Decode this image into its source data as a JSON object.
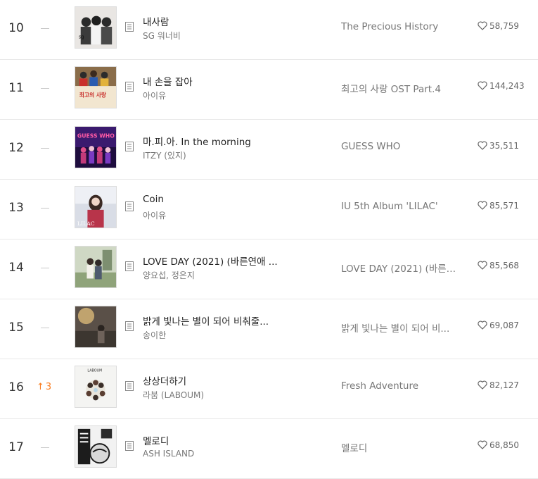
{
  "rows": [
    {
      "rank": "10",
      "change": "static",
      "change_value": "",
      "title": "내사람",
      "artist": "SG 워너비",
      "album": "The Precious History",
      "likes": "58,759"
    },
    {
      "rank": "11",
      "change": "static",
      "change_value": "",
      "title": "내 손을 잡아",
      "artist": "아이유",
      "album": "최고의 사랑 OST Part.4",
      "likes": "144,243"
    },
    {
      "rank": "12",
      "change": "static",
      "change_value": "",
      "title": "마.피.아. In the morning",
      "artist": "ITZY (있지)",
      "album": "GUESS WHO",
      "likes": "35,511"
    },
    {
      "rank": "13",
      "change": "static",
      "change_value": "",
      "title": "Coin",
      "artist": "아이유",
      "album": "IU 5th Album 'LILAC'",
      "likes": "85,571"
    },
    {
      "rank": "14",
      "change": "static",
      "change_value": "",
      "title": "LOVE DAY (2021) (바른연애 ...",
      "artist": "양요섭, 정은지",
      "album": "LOVE DAY (2021) (바른연...",
      "likes": "85,568"
    },
    {
      "rank": "15",
      "change": "static",
      "change_value": "",
      "title": "밝게 빛나는 별이 되어 비춰줄...",
      "artist": "송이한",
      "album": "밝게 빛나는 별이 되어 비...",
      "likes": "69,087"
    },
    {
      "rank": "16",
      "change": "up",
      "change_value": "3",
      "title": "상상더하기",
      "artist": "라붐 (LABOUM)",
      "album": "Fresh Adventure",
      "likes": "82,127"
    },
    {
      "rank": "17",
      "change": "static",
      "change_value": "",
      "title": "멜로디",
      "artist": "ASH ISLAND",
      "album": "멜로디",
      "likes": "68,850"
    }
  ],
  "cover_text": {
    "row0": "sg",
    "row1": "최고의 사랑",
    "row2": "GUESS WHO",
    "row3": "LILAC",
    "row6": "LABOUM"
  },
  "colors": {
    "up": "#fa7d20",
    "static_dash": "#c8c8c8",
    "divider": "#e8e8e8"
  },
  "icons": {
    "lyrics": "document-icon",
    "like": "heart-outline-icon",
    "change_up": "arrow-up-icon",
    "change_static": "dash-icon"
  }
}
